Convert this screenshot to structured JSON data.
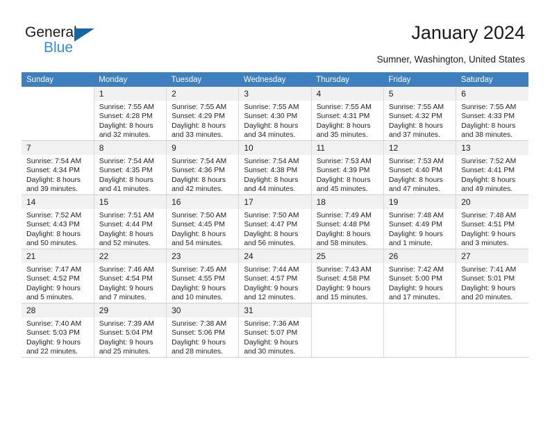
{
  "brand": {
    "name_top": "General",
    "name_bottom": "Blue",
    "accent_color": "#2f8fd8",
    "triangle_color": "#1565a8"
  },
  "header": {
    "title": "January 2024",
    "subtitle": "Sumner, Washington, United States"
  },
  "calendar": {
    "header_bg": "#3d7fbf",
    "daynum_bg": "#f1f1f1",
    "weekday_names": [
      "Sunday",
      "Monday",
      "Tuesday",
      "Wednesday",
      "Thursday",
      "Friday",
      "Saturday"
    ],
    "leading_blanks": 1,
    "weeks": [
      [
        {
          "empty": true
        },
        {
          "day": "1",
          "sunrise": "Sunrise: 7:55 AM",
          "sunset": "Sunset: 4:28 PM",
          "daylight1": "Daylight: 8 hours",
          "daylight2": "and 32 minutes."
        },
        {
          "day": "2",
          "sunrise": "Sunrise: 7:55 AM",
          "sunset": "Sunset: 4:29 PM",
          "daylight1": "Daylight: 8 hours",
          "daylight2": "and 33 minutes."
        },
        {
          "day": "3",
          "sunrise": "Sunrise: 7:55 AM",
          "sunset": "Sunset: 4:30 PM",
          "daylight1": "Daylight: 8 hours",
          "daylight2": "and 34 minutes."
        },
        {
          "day": "4",
          "sunrise": "Sunrise: 7:55 AM",
          "sunset": "Sunset: 4:31 PM",
          "daylight1": "Daylight: 8 hours",
          "daylight2": "and 35 minutes."
        },
        {
          "day": "5",
          "sunrise": "Sunrise: 7:55 AM",
          "sunset": "Sunset: 4:32 PM",
          "daylight1": "Daylight: 8 hours",
          "daylight2": "and 37 minutes."
        },
        {
          "day": "6",
          "sunrise": "Sunrise: 7:55 AM",
          "sunset": "Sunset: 4:33 PM",
          "daylight1": "Daylight: 8 hours",
          "daylight2": "and 38 minutes."
        }
      ],
      [
        {
          "day": "7",
          "sunrise": "Sunrise: 7:54 AM",
          "sunset": "Sunset: 4:34 PM",
          "daylight1": "Daylight: 8 hours",
          "daylight2": "and 39 minutes."
        },
        {
          "day": "8",
          "sunrise": "Sunrise: 7:54 AM",
          "sunset": "Sunset: 4:35 PM",
          "daylight1": "Daylight: 8 hours",
          "daylight2": "and 41 minutes."
        },
        {
          "day": "9",
          "sunrise": "Sunrise: 7:54 AM",
          "sunset": "Sunset: 4:36 PM",
          "daylight1": "Daylight: 8 hours",
          "daylight2": "and 42 minutes."
        },
        {
          "day": "10",
          "sunrise": "Sunrise: 7:54 AM",
          "sunset": "Sunset: 4:38 PM",
          "daylight1": "Daylight: 8 hours",
          "daylight2": "and 44 minutes."
        },
        {
          "day": "11",
          "sunrise": "Sunrise: 7:53 AM",
          "sunset": "Sunset: 4:39 PM",
          "daylight1": "Daylight: 8 hours",
          "daylight2": "and 45 minutes."
        },
        {
          "day": "12",
          "sunrise": "Sunrise: 7:53 AM",
          "sunset": "Sunset: 4:40 PM",
          "daylight1": "Daylight: 8 hours",
          "daylight2": "and 47 minutes."
        },
        {
          "day": "13",
          "sunrise": "Sunrise: 7:52 AM",
          "sunset": "Sunset: 4:41 PM",
          "daylight1": "Daylight: 8 hours",
          "daylight2": "and 49 minutes."
        }
      ],
      [
        {
          "day": "14",
          "sunrise": "Sunrise: 7:52 AM",
          "sunset": "Sunset: 4:43 PM",
          "daylight1": "Daylight: 8 hours",
          "daylight2": "and 50 minutes."
        },
        {
          "day": "15",
          "sunrise": "Sunrise: 7:51 AM",
          "sunset": "Sunset: 4:44 PM",
          "daylight1": "Daylight: 8 hours",
          "daylight2": "and 52 minutes."
        },
        {
          "day": "16",
          "sunrise": "Sunrise: 7:50 AM",
          "sunset": "Sunset: 4:45 PM",
          "daylight1": "Daylight: 8 hours",
          "daylight2": "and 54 minutes."
        },
        {
          "day": "17",
          "sunrise": "Sunrise: 7:50 AM",
          "sunset": "Sunset: 4:47 PM",
          "daylight1": "Daylight: 8 hours",
          "daylight2": "and 56 minutes."
        },
        {
          "day": "18",
          "sunrise": "Sunrise: 7:49 AM",
          "sunset": "Sunset: 4:48 PM",
          "daylight1": "Daylight: 8 hours",
          "daylight2": "and 58 minutes."
        },
        {
          "day": "19",
          "sunrise": "Sunrise: 7:48 AM",
          "sunset": "Sunset: 4:49 PM",
          "daylight1": "Daylight: 9 hours",
          "daylight2": "and 1 minute."
        },
        {
          "day": "20",
          "sunrise": "Sunrise: 7:48 AM",
          "sunset": "Sunset: 4:51 PM",
          "daylight1": "Daylight: 9 hours",
          "daylight2": "and 3 minutes."
        }
      ],
      [
        {
          "day": "21",
          "sunrise": "Sunrise: 7:47 AM",
          "sunset": "Sunset: 4:52 PM",
          "daylight1": "Daylight: 9 hours",
          "daylight2": "and 5 minutes."
        },
        {
          "day": "22",
          "sunrise": "Sunrise: 7:46 AM",
          "sunset": "Sunset: 4:54 PM",
          "daylight1": "Daylight: 9 hours",
          "daylight2": "and 7 minutes."
        },
        {
          "day": "23",
          "sunrise": "Sunrise: 7:45 AM",
          "sunset": "Sunset: 4:55 PM",
          "daylight1": "Daylight: 9 hours",
          "daylight2": "and 10 minutes."
        },
        {
          "day": "24",
          "sunrise": "Sunrise: 7:44 AM",
          "sunset": "Sunset: 4:57 PM",
          "daylight1": "Daylight: 9 hours",
          "daylight2": "and 12 minutes."
        },
        {
          "day": "25",
          "sunrise": "Sunrise: 7:43 AM",
          "sunset": "Sunset: 4:58 PM",
          "daylight1": "Daylight: 9 hours",
          "daylight2": "and 15 minutes."
        },
        {
          "day": "26",
          "sunrise": "Sunrise: 7:42 AM",
          "sunset": "Sunset: 5:00 PM",
          "daylight1": "Daylight: 9 hours",
          "daylight2": "and 17 minutes."
        },
        {
          "day": "27",
          "sunrise": "Sunrise: 7:41 AM",
          "sunset": "Sunset: 5:01 PM",
          "daylight1": "Daylight: 9 hours",
          "daylight2": "and 20 minutes."
        }
      ],
      [
        {
          "day": "28",
          "sunrise": "Sunrise: 7:40 AM",
          "sunset": "Sunset: 5:03 PM",
          "daylight1": "Daylight: 9 hours",
          "daylight2": "and 22 minutes."
        },
        {
          "day": "29",
          "sunrise": "Sunrise: 7:39 AM",
          "sunset": "Sunset: 5:04 PM",
          "daylight1": "Daylight: 9 hours",
          "daylight2": "and 25 minutes."
        },
        {
          "day": "30",
          "sunrise": "Sunrise: 7:38 AM",
          "sunset": "Sunset: 5:06 PM",
          "daylight1": "Daylight: 9 hours",
          "daylight2": "and 28 minutes."
        },
        {
          "day": "31",
          "sunrise": "Sunrise: 7:36 AM",
          "sunset": "Sunset: 5:07 PM",
          "daylight1": "Daylight: 9 hours",
          "daylight2": "and 30 minutes."
        },
        {
          "empty": true
        },
        {
          "empty": true
        },
        {
          "empty": true
        }
      ]
    ]
  }
}
